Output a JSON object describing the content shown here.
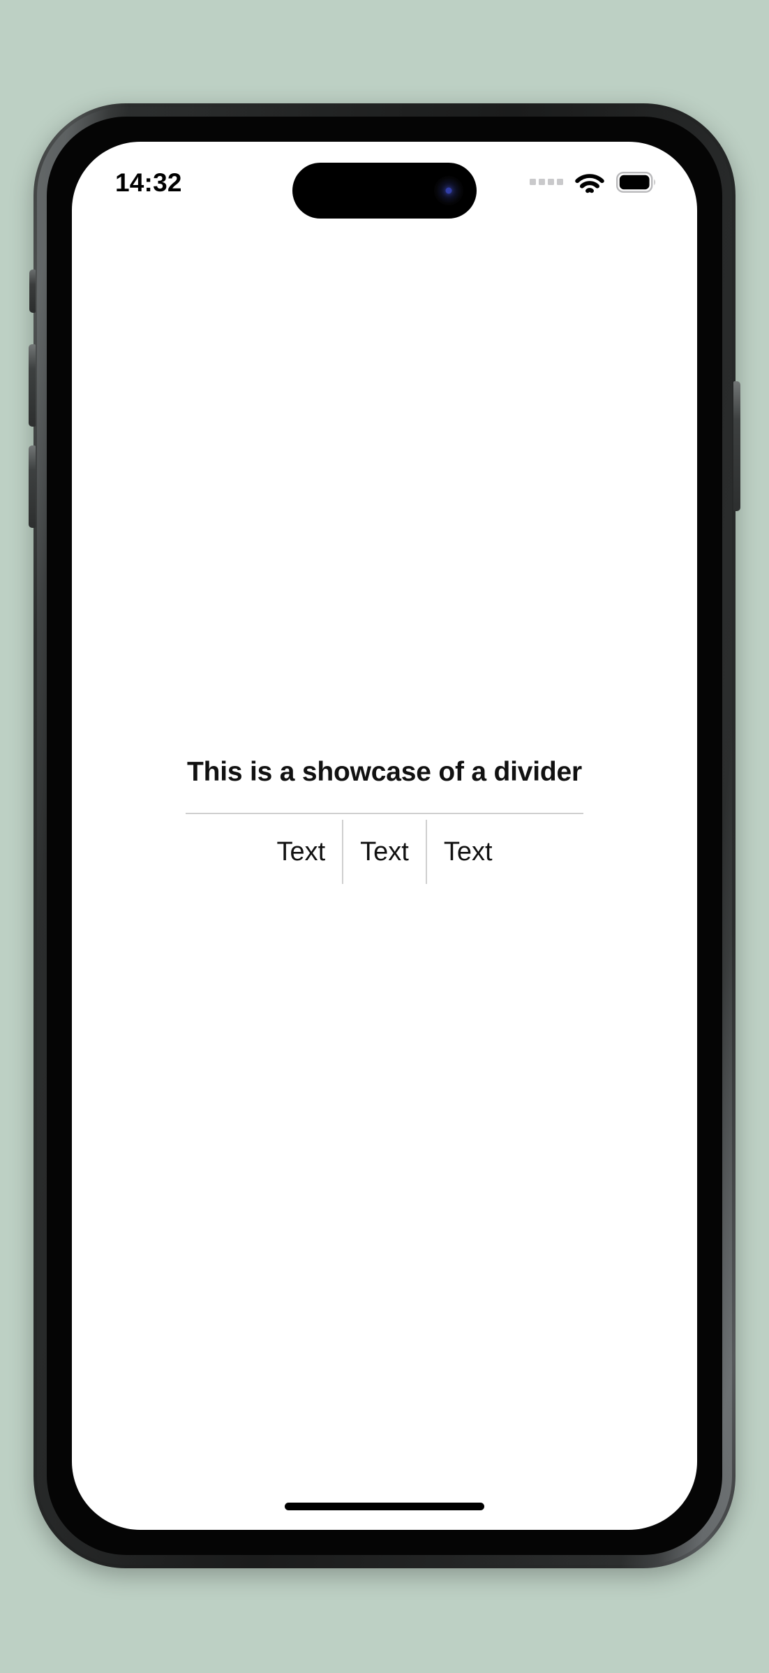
{
  "canvas": {
    "background_color": "#bdd0c4"
  },
  "device": {
    "name": "iphone-mockup",
    "frame_color": "#2a2c2c",
    "screen_background": "#ffffff",
    "buttons": {
      "silent_switch": "silent-switch",
      "volume_up": "volume-up-button",
      "volume_down": "volume-down-button",
      "power": "power-button"
    }
  },
  "status_bar": {
    "time": "14:32",
    "cellular_dots": 4,
    "cellular_color": "#c9c9cb",
    "wifi_icon": "wifi-icon",
    "battery_icon": "battery-icon",
    "battery_level_full": true,
    "icon_color": "#000000"
  },
  "dynamic_island": {
    "name": "dynamic-island",
    "camera_lens": "front-camera-lens",
    "color": "#000000"
  },
  "screen": {
    "heading": "This is a showcase of a divider",
    "divider_color": "#cfcfcf",
    "text_items": [
      {
        "label": "Text"
      },
      {
        "label": "Text"
      },
      {
        "label": "Text"
      }
    ]
  },
  "home_indicator": {
    "name": "home-indicator",
    "color": "#000000"
  }
}
